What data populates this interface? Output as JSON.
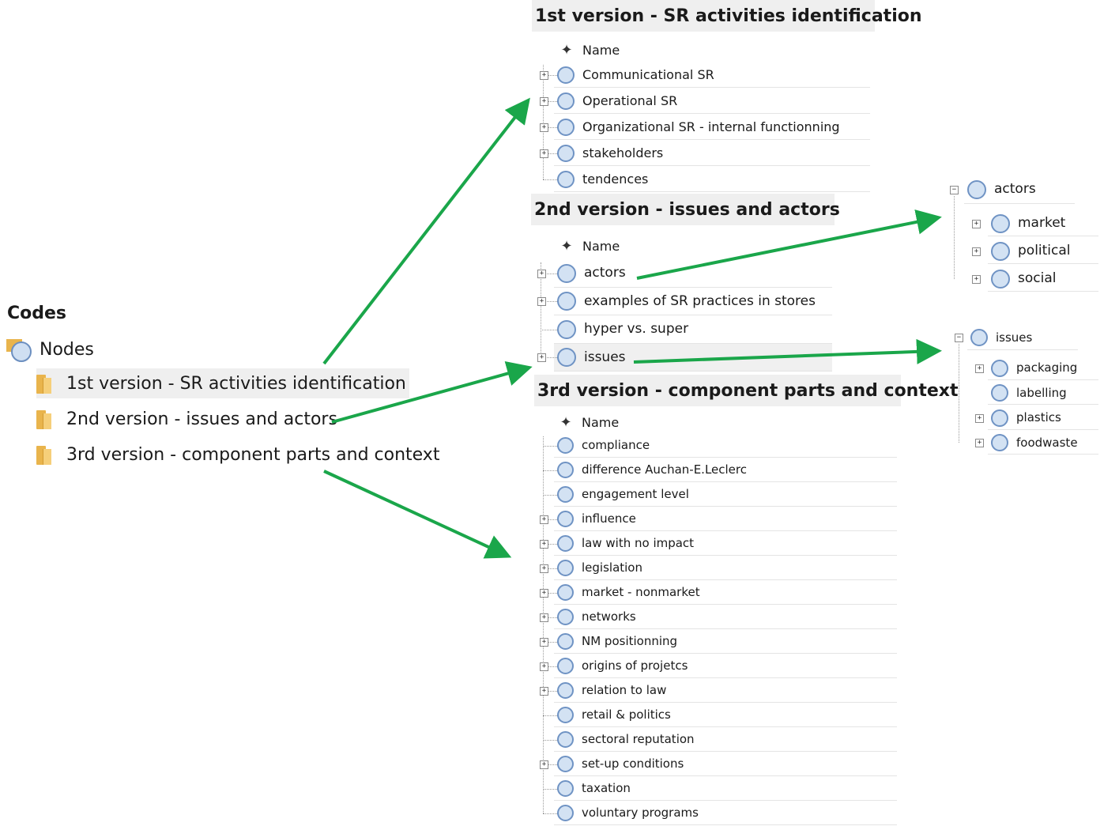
{
  "left": {
    "title": "Codes",
    "nodes_label": "Nodes",
    "items": [
      {
        "label": "1st version - SR activities identification"
      },
      {
        "label": "2nd version - issues and actors"
      },
      {
        "label": "3rd version - component parts and context"
      }
    ]
  },
  "panel1": {
    "title": "1st version  -  SR activities identification",
    "column_header": "Name",
    "rows": [
      {
        "label": "Communicational SR",
        "expandable": true
      },
      {
        "label": "Operational SR",
        "expandable": true
      },
      {
        "label": "Organizational SR - internal functionning",
        "expandable": true
      },
      {
        "label": "stakeholders",
        "expandable": true
      },
      {
        "label": "tendences",
        "expandable": false
      }
    ]
  },
  "panel2": {
    "title": "2nd version  -  issues and actors",
    "column_header": "Name",
    "rows": [
      {
        "label": "actors",
        "expandable": true
      },
      {
        "label": "examples of SR practices in stores",
        "expandable": true
      },
      {
        "label": "hyper vs. super",
        "expandable": false
      },
      {
        "label": "issues",
        "expandable": true
      }
    ]
  },
  "panel3": {
    "title": "3rd version  -  component parts and context",
    "column_header": "Name",
    "rows": [
      {
        "label": "compliance",
        "expandable": false
      },
      {
        "label": "difference Auchan-E.Leclerc",
        "expandable": false
      },
      {
        "label": "engagement level",
        "expandable": false
      },
      {
        "label": "influence",
        "expandable": true
      },
      {
        "label": "law with no impact",
        "expandable": true
      },
      {
        "label": "legislation",
        "expandable": true
      },
      {
        "label": "market - nonmarket",
        "expandable": true
      },
      {
        "label": "networks",
        "expandable": true
      },
      {
        "label": "NM positionning",
        "expandable": true
      },
      {
        "label": "origins of projetcs",
        "expandable": true
      },
      {
        "label": "relation to law",
        "expandable": true
      },
      {
        "label": "retail & politics",
        "expandable": false
      },
      {
        "label": "sectoral reputation",
        "expandable": false
      },
      {
        "label": "set-up conditions",
        "expandable": true
      },
      {
        "label": "taxation",
        "expandable": false
      },
      {
        "label": "voluntary programs",
        "expandable": false
      }
    ]
  },
  "actors_tree": {
    "root": "actors",
    "children": [
      {
        "label": "market"
      },
      {
        "label": "political"
      },
      {
        "label": "social"
      }
    ]
  },
  "issues_tree": {
    "root": "issues",
    "children": [
      {
        "label": "packaging",
        "expandable": true
      },
      {
        "label": "labelling",
        "expandable": false
      },
      {
        "label": "plastics",
        "expandable": true
      },
      {
        "label": "foodwaste",
        "expandable": true
      }
    ]
  },
  "colors": {
    "arrow": "#1aa64a",
    "node_fill": "#d3e2f3",
    "node_border": "#6f93c4",
    "folder": "#e9b44c",
    "selection": "#efefef"
  },
  "icons": {
    "pin": "pin-icon",
    "node": "node-circle-icon",
    "folder": "folder-icon",
    "expander": "expand-plus-icon"
  }
}
